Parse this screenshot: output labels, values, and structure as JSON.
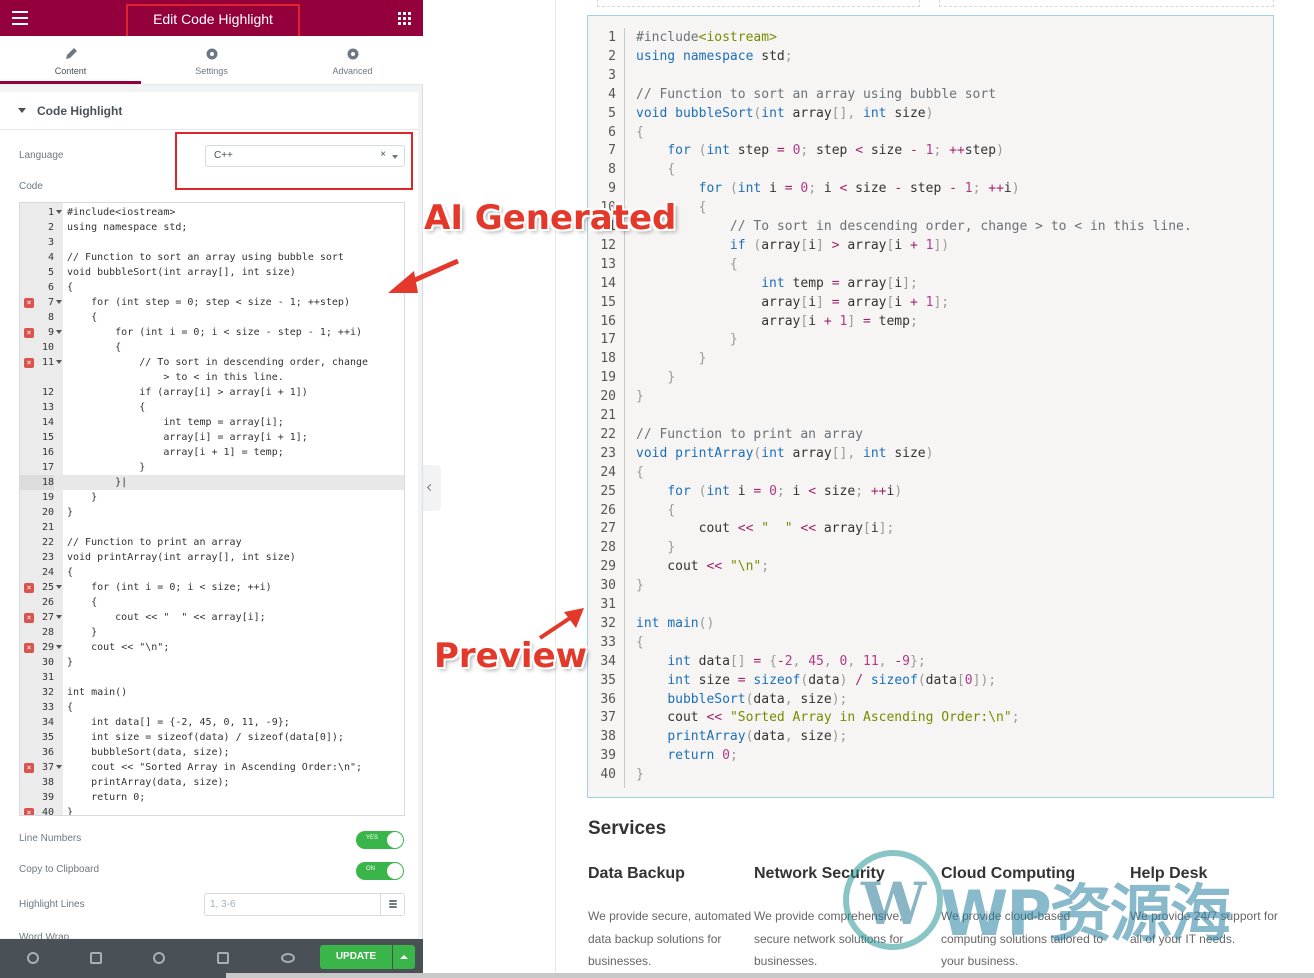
{
  "panel": {
    "title": "Edit Code Highlight",
    "tabs": [
      {
        "label": "Content",
        "icon": "pencil-icon"
      },
      {
        "label": "Settings",
        "icon": "gear-icon"
      },
      {
        "label": "Advanced",
        "icon": "gear-icon"
      }
    ],
    "section_title": "Code Highlight",
    "language_label": "Language",
    "language_value": "C++",
    "code_label": "Code",
    "line_numbers_label": "Line Numbers",
    "line_numbers_state": "YES",
    "copy_label": "Copy to Clipboard",
    "copy_state": "ON",
    "highlight_label": "Highlight Lines",
    "highlight_placeholder": "1, 3-6",
    "word_wrap_label": "Word Wrap",
    "update_label": "UPDATE"
  },
  "editor": {
    "lines": [
      {
        "n": "1",
        "t": "#include<iostream>",
        "fold": true
      },
      {
        "n": "2",
        "t": "using namespace std;"
      },
      {
        "n": "3",
        "t": ""
      },
      {
        "n": "4",
        "t": "// Function to sort an array using bubble sort"
      },
      {
        "n": "5",
        "t": "void bubbleSort(int array[], int size)"
      },
      {
        "n": "6",
        "t": "{"
      },
      {
        "n": "7",
        "t": "    for (int step = 0; step < size - 1; ++step)",
        "fold": true,
        "err": true
      },
      {
        "n": "8",
        "t": "    {"
      },
      {
        "n": "9",
        "t": "        for (int i = 0; i < size - step - 1; ++i)",
        "fold": true,
        "err": true
      },
      {
        "n": "10",
        "t": "        {"
      },
      {
        "n": "11",
        "t": "            // To sort in descending order, change",
        "fold": true,
        "err": true
      },
      {
        "n": "",
        "t": "                > to < in this line."
      },
      {
        "n": "12",
        "t": "            if (array[i] > array[i + 1])"
      },
      {
        "n": "13",
        "t": "            {"
      },
      {
        "n": "14",
        "t": "                int temp = array[i];"
      },
      {
        "n": "15",
        "t": "                array[i] = array[i + 1];"
      },
      {
        "n": "16",
        "t": "                array[i + 1] = temp;"
      },
      {
        "n": "17",
        "t": "            }"
      },
      {
        "n": "18",
        "t": "        }|",
        "active": true
      },
      {
        "n": "19",
        "t": "    }"
      },
      {
        "n": "20",
        "t": "}"
      },
      {
        "n": "21",
        "t": ""
      },
      {
        "n": "22",
        "t": "// Function to print an array"
      },
      {
        "n": "23",
        "t": "void printArray(int array[], int size)"
      },
      {
        "n": "24",
        "t": "{"
      },
      {
        "n": "25",
        "t": "    for (int i = 0; i < size; ++i)",
        "fold": true,
        "err": true
      },
      {
        "n": "26",
        "t": "    {"
      },
      {
        "n": "27",
        "t": "        cout << \"  \" << array[i];",
        "fold": true,
        "err": true
      },
      {
        "n": "28",
        "t": "    }"
      },
      {
        "n": "29",
        "t": "    cout << \"\\n\";",
        "fold": true,
        "err": true
      },
      {
        "n": "30",
        "t": "}"
      },
      {
        "n": "31",
        "t": ""
      },
      {
        "n": "32",
        "t": "int main()"
      },
      {
        "n": "33",
        "t": "{"
      },
      {
        "n": "34",
        "t": "    int data[] = {-2, 45, 0, 11, -9};"
      },
      {
        "n": "35",
        "t": "    int size = sizeof(data) / sizeof(data[0]);"
      },
      {
        "n": "36",
        "t": "    bubbleSort(data, size);"
      },
      {
        "n": "37",
        "t": "    cout << \"Sorted Array in Ascending Order:\\n\";",
        "fold": true,
        "err": true
      },
      {
        "n": "38",
        "t": "    printArray(data, size);"
      },
      {
        "n": "39",
        "t": "    return 0;"
      },
      {
        "n": "40",
        "t": "}",
        "err": true
      }
    ]
  },
  "annotations": {
    "ai": "AI Generated",
    "preview": "Preview"
  },
  "preview": {
    "lines": [
      "#include<iostream>",
      "using namespace std;",
      "",
      "// Function to sort an array using bubble sort",
      "void bubbleSort(int array[], int size)",
      "{",
      "    for (int step = 0; step < size - 1; ++step)",
      "    {",
      "        for (int i = 0; i < size - step - 1; ++i)",
      "        {",
      "            // To sort in descending order, change > to < in this line.",
      "            if (array[i] > array[i + 1])",
      "            {",
      "                int temp = array[i];",
      "                array[i] = array[i + 1];",
      "                array[i + 1] = temp;",
      "            }",
      "        }",
      "    }",
      "}",
      "",
      "// Function to print an array",
      "void printArray(int array[], int size)",
      "{",
      "    for (int i = 0; i < size; ++i)",
      "    {",
      "        cout << \"  \" << array[i];",
      "    }",
      "    cout << \"\\n\";",
      "}",
      "",
      "int main()",
      "{",
      "    int data[] = {-2, 45, 0, 11, -9};",
      "    int size = sizeof(data) / sizeof(data[0]);",
      "    bubbleSort(data, size);",
      "    cout << \"Sorted Array in Ascending Order:\\n\";",
      "    printArray(data, size);",
      "    return 0;",
      "}"
    ],
    "services_title": "Services",
    "services": [
      {
        "name": "Data Backup",
        "desc": "We provide secure, automated data backup solutions for businesses."
      },
      {
        "name": "Network Security",
        "desc": "We provide comprehensive, secure network solutions for businesses."
      },
      {
        "name": "Cloud Computing",
        "desc": "We provide cloud-based computing solutions tailored to your business."
      },
      {
        "name": "Help Desk",
        "desc": "We provide 24/7 support for all of your IT needs."
      }
    ]
  },
  "watermark": {
    "text": "WP资源海"
  }
}
